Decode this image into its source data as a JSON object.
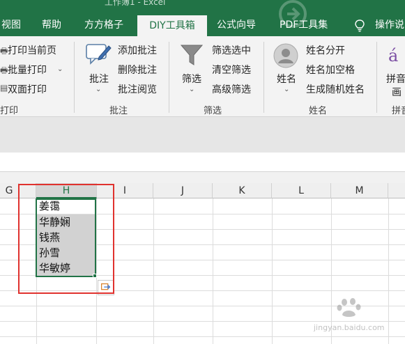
{
  "window": {
    "title": "工作簿1 - Excel"
  },
  "tabs": [
    {
      "label": "视图"
    },
    {
      "label": "帮助"
    },
    {
      "label": "方方格子"
    },
    {
      "label": "DIY工具箱",
      "active": true
    },
    {
      "label": "公式向导"
    },
    {
      "label": "PDF工具集"
    },
    {
      "label": "操作说"
    }
  ],
  "ribbon": {
    "print": {
      "items": [
        "打印当前页",
        "批量打印",
        "双面打印"
      ],
      "group_label": "打印"
    },
    "comment": {
      "big_button": "批注",
      "items": [
        "添加批注",
        "删除批注",
        "批注阅览"
      ],
      "group_label": "批注"
    },
    "filter": {
      "big_button": "筛选",
      "items": [
        "筛选选中",
        "清空筛选",
        "高级筛选"
      ],
      "group_label": "筛选"
    },
    "name": {
      "big_button": "姓名",
      "items": [
        "姓名分开",
        "姓名加空格",
        "生成随机姓名"
      ],
      "group_label": "姓名"
    },
    "pinyin": {
      "big_button": "拼音",
      "big_button_line2": "画",
      "group_label": "拼音"
    }
  },
  "columns": [
    "G",
    "H",
    "I",
    "J",
    "K",
    "L",
    "M"
  ],
  "selected_column": "H",
  "cells": {
    "H": [
      "姜霭",
      "华静娴",
      "钱燕",
      "孙雪",
      "华敏婷"
    ]
  },
  "highlighted_rows": [
    1,
    2,
    3,
    4
  ],
  "watermark": {
    "text": "jingyan.baidu.com"
  },
  "colors": {
    "excel_green": "#217346",
    "ribbon_bg": "#f3f3f3",
    "selection_fill": "#d2d2d2",
    "annotation_red": "#e0322e"
  }
}
